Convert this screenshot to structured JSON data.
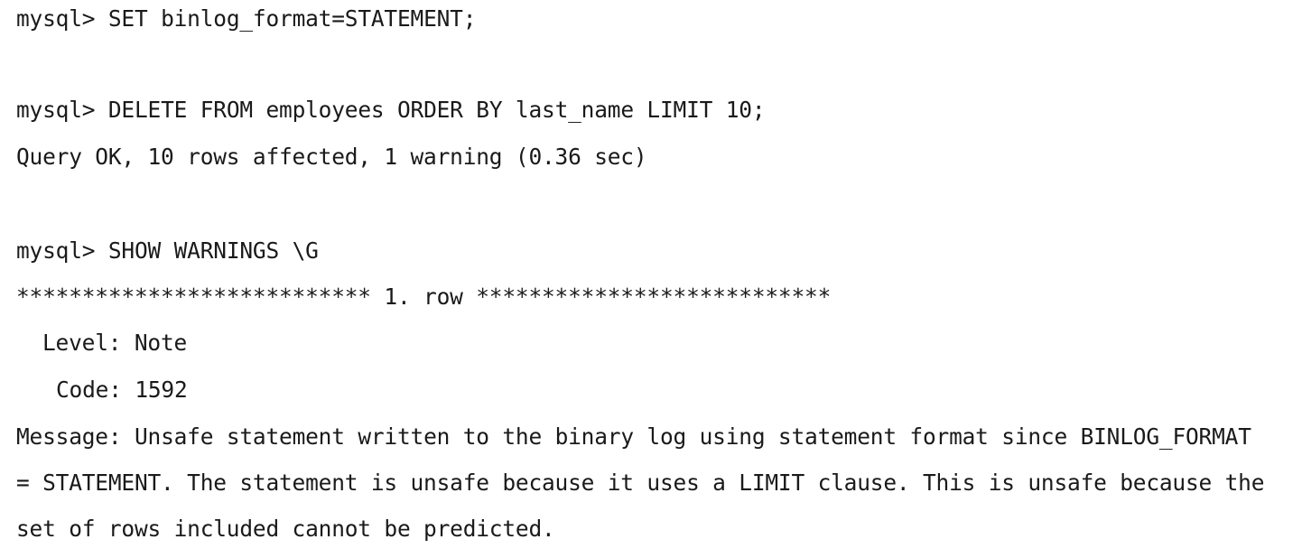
{
  "terminal": {
    "prompt": "mysql>",
    "cmd_set_binlog": "SET binlog_format=STATEMENT;",
    "cmd_delete": "DELETE FROM employees ORDER BY last_name LIMIT 10;",
    "result_delete": "Query OK, 10 rows affected, 1 warning (0.36 sec)",
    "cmd_show_warnings": "SHOW WARNINGS \\G",
    "row_separator": "*************************** 1. row ***************************",
    "warning": {
      "level_label": "Level:",
      "level_value": "Note",
      "code_label": "Code:",
      "code_value": "1592",
      "message_label": "Message:",
      "message_line1": "Unsafe statement written to the binary log using statement format since BINLOG_FORMAT",
      "message_line2": "= STATEMENT. The statement is unsafe because it uses a LIMIT clause. This is unsafe because the",
      "message_line3": "set of rows included cannot be predicted."
    }
  }
}
